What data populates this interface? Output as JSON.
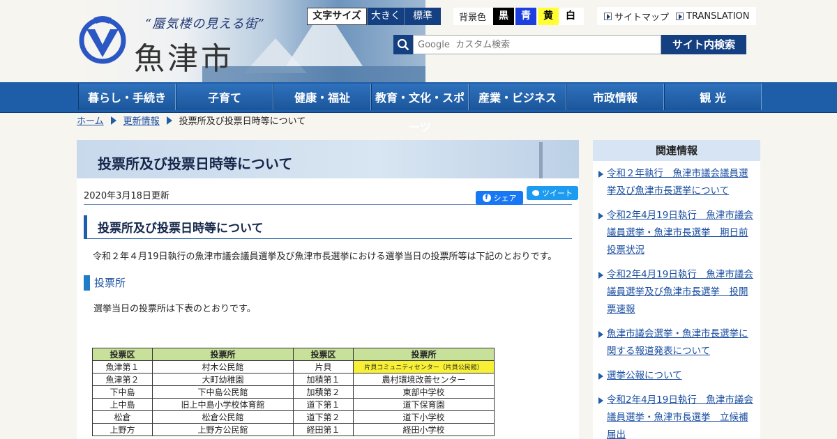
{
  "header": {
    "slogan": "“蜃気楼の見える街”",
    "city_name": "魚津市",
    "text_size": {
      "label": "文字サイズ",
      "large": "大きく",
      "standard": "標準"
    },
    "bg_color": {
      "label": "背景色",
      "black": "黒",
      "blue": "青",
      "yellow": "黄",
      "white": "白"
    },
    "sitemap": "サイトマップ",
    "translation": "TRANSLATION",
    "search": {
      "placeholder": "Google  カスタム検索",
      "button": "サイト内検索"
    }
  },
  "nav": [
    "暮らし・手続き",
    "子育て",
    "健康・福祉",
    "教育・文化・スポーツ",
    "産業・ビジネス",
    "市政情報",
    "観 光"
  ],
  "breadcrumb": {
    "home": "ホーム",
    "updates": "更新情報",
    "current": "投票所及び投票日時等について"
  },
  "main": {
    "title": "投票所及び投票日時等について",
    "updated": "2020年3月18日更新",
    "share": "シェア",
    "tweet": "ツイート",
    "section_title": "投票所及び投票日時等について",
    "intro": "令和２年４月19日執行の魚津市議会議員選挙及び魚津市長選挙における選挙当日の投票所等は下記のとおりです。",
    "subsection": "投票所",
    "subtext": "選挙当日の投票所は下表のとおりです。",
    "table": {
      "headers": [
        "投票区",
        "投票所",
        "投票区",
        "投票所"
      ],
      "rows": [
        [
          "魚津第１",
          "村木公民館",
          "片貝",
          "片貝コミュニティセンター（片貝公民館）"
        ],
        [
          "魚津第２",
          "大町幼稚園",
          "加積第１",
          "農村環境改善センター"
        ],
        [
          "下中島",
          "下中島公民館",
          "加積第２",
          "東部中学校"
        ],
        [
          "上中島",
          "旧上中島小学校体育館",
          "道下第１",
          "道下保育園"
        ],
        [
          "松倉",
          "松倉公民館",
          "道下第２",
          "道下小学校"
        ],
        [
          "上野方",
          "上野方公民館",
          "経田第１",
          "経田小学校"
        ]
      ]
    }
  },
  "sidebar": {
    "title": "関連情報",
    "items": [
      "令和２年執行　魚津市議会議員選挙及び魚津市長選挙について",
      "令和2年4月19日執行　魚津市議会議員選挙・魚津市長選挙　期日前投票状況",
      "令和2年4月19日執行　魚津市議会議員選挙及び魚津市長選挙　投開票速報",
      "魚津市議会選挙・魚津市長選挙に関する報道発表について",
      "選挙公報について",
      "令和2年4月19日執行　魚津市議会議員選挙・魚津市長選挙　立候補届出"
    ]
  },
  "colors": {
    "brand_blue": "#143f80",
    "nav_blue": "#1e5ea8",
    "link": "#1a4ea1",
    "highlight": "#f7f035",
    "table_header": "#c7e09a"
  }
}
